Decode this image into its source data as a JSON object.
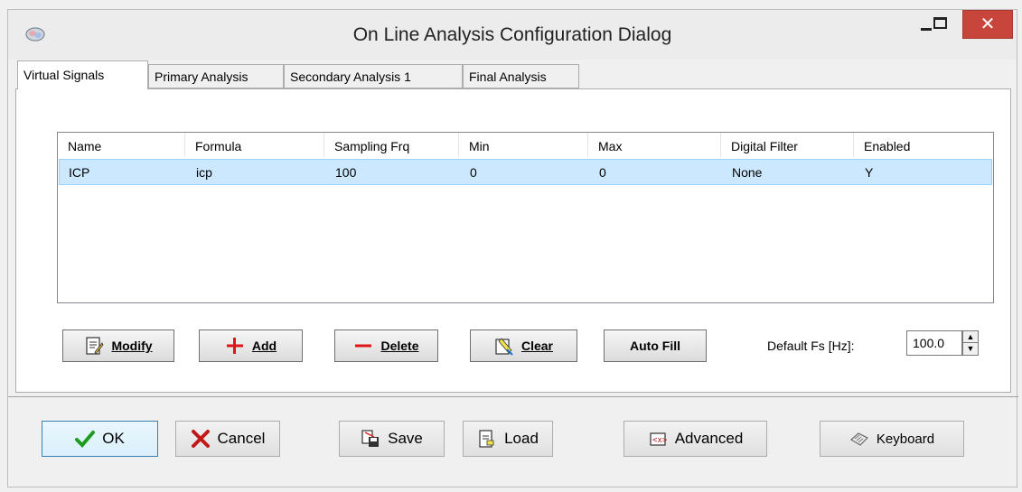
{
  "window": {
    "title": "On Line Analysis Configuration Dialog",
    "close_glyph": "✕"
  },
  "tabs": [
    {
      "label": "Virtual Signals",
      "active": true
    },
    {
      "label": "Primary Analysis"
    },
    {
      "label": "Secondary Analysis 1"
    },
    {
      "label": "Final Analysis"
    }
  ],
  "table": {
    "columns": [
      "Name",
      "Formula",
      "Sampling Frq",
      "Min",
      "Max",
      "Digital Filter",
      "Enabled"
    ],
    "rows": [
      [
        "ICP",
        "icp",
        "100",
        "0",
        "0",
        "None",
        "Y"
      ]
    ]
  },
  "list_buttons": {
    "modify": {
      "label": "Modify",
      "icon": "modify-icon"
    },
    "add": {
      "label": "Add",
      "icon": "plus-icon"
    },
    "delete": {
      "label": "Delete",
      "icon": "minus-icon"
    },
    "clear": {
      "label": "Clear",
      "icon": "clear-icon"
    },
    "auto_fill": {
      "label": "Auto Fill"
    }
  },
  "default_fs": {
    "label": "Default Fs [Hz]:",
    "value": "100.0"
  },
  "dialog_buttons": {
    "ok": {
      "label": "OK",
      "icon": "checkmark-icon"
    },
    "cancel": {
      "label": "Cancel",
      "icon": "x-icon"
    },
    "save": {
      "label": "Save",
      "icon": "save-icon"
    },
    "load": {
      "label": "Load",
      "icon": "load-icon"
    },
    "advanced": {
      "label": "Advanced",
      "icon": "advanced-icon"
    },
    "keyboard": {
      "label": "Keyboard",
      "icon": "keyboard-icon"
    }
  },
  "colors": {
    "selection": "#cce8ff",
    "close_button": "#c7453b",
    "ok_check": "#1e9c1e",
    "cancel_x": "#c11818",
    "add_plus": "#e01515",
    "delete_minus": "#e01515"
  }
}
